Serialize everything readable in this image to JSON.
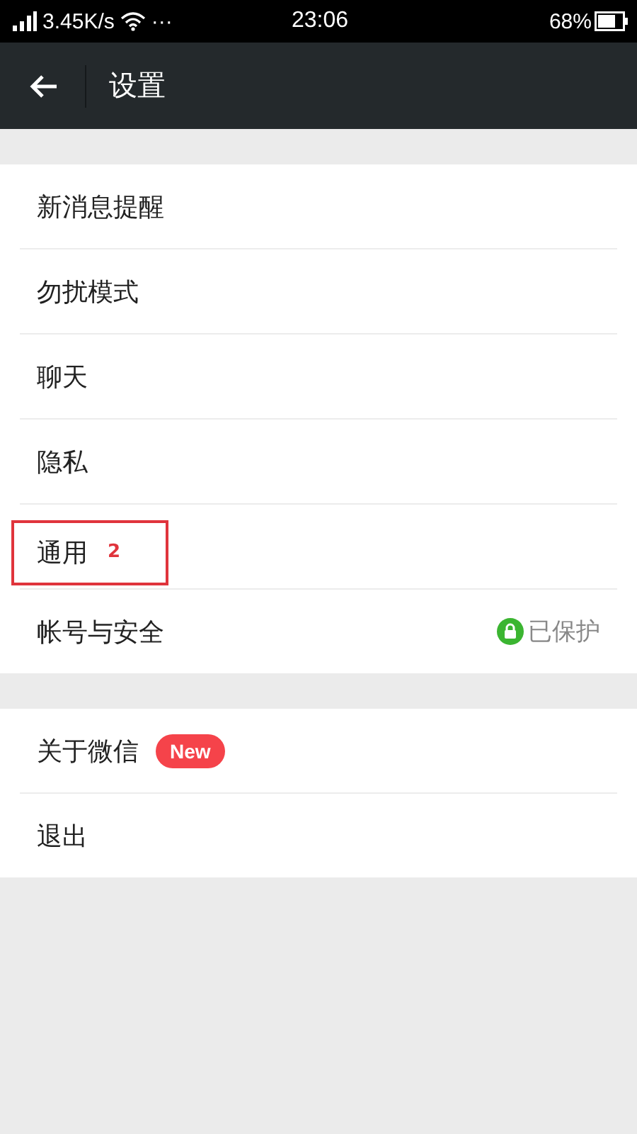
{
  "status_bar": {
    "speed": "3.45K/s",
    "more": "···",
    "time": "23:06",
    "battery": "68%"
  },
  "header": {
    "title": "设置"
  },
  "groups": [
    {
      "items": [
        {
          "label": "新消息提醒"
        },
        {
          "label": "勿扰模式"
        },
        {
          "label": "聊天"
        },
        {
          "label": "隐私"
        },
        {
          "label": "通用",
          "annotation": "2"
        },
        {
          "label": "帐号与安全",
          "status": "已保护"
        }
      ]
    },
    {
      "items": [
        {
          "label": "关于微信",
          "badge": "New"
        },
        {
          "label": "退出"
        }
      ]
    }
  ]
}
